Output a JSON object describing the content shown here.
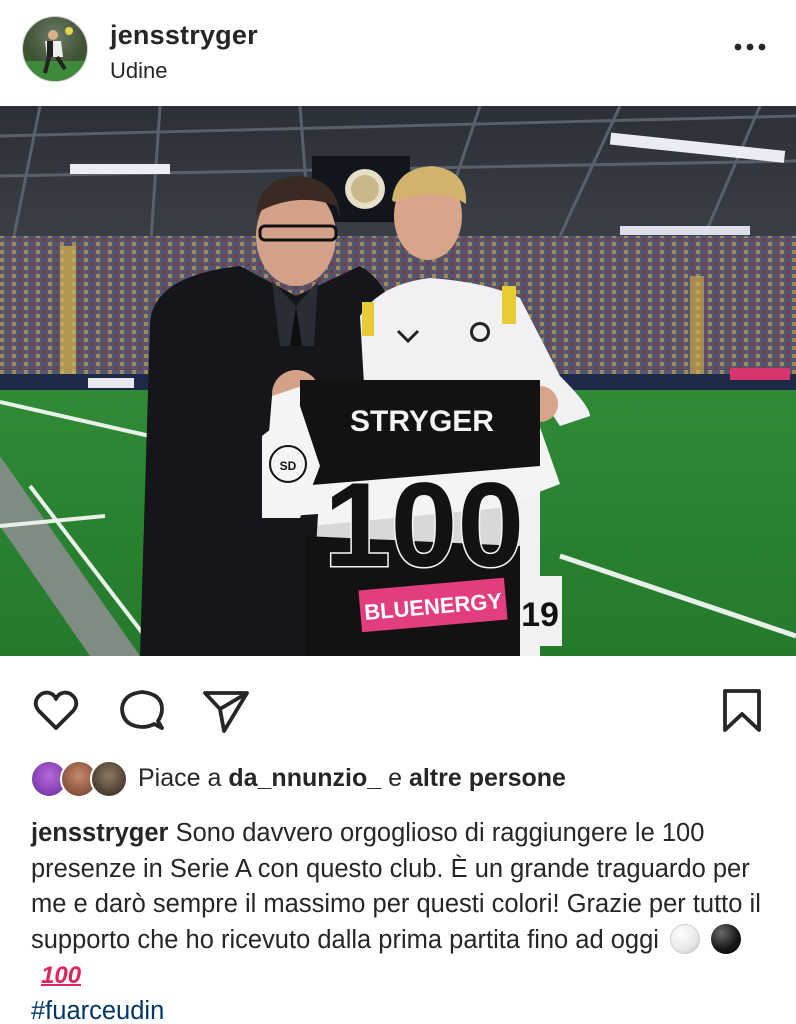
{
  "post": {
    "username": "jensstryger",
    "location": "Udine",
    "more_icon": "more-horizontal-icon"
  },
  "photo": {
    "shirt_name": "STRYGER",
    "shirt_number": "100",
    "sponsor": "BLUENERGY",
    "player_number": "19",
    "colors": {
      "sponsor_pink": "#e23d7f",
      "shirt_black": "#121212",
      "shirt_white": "#f4f4f4"
    }
  },
  "actions": {
    "like_icon": "heart-icon",
    "comment_icon": "comment-icon",
    "share_icon": "send-icon",
    "save_icon": "bookmark-icon"
  },
  "likes": {
    "prefix": "Piace a",
    "user": "da_nnunzio_",
    "connector": "e",
    "suffix": "altre persone"
  },
  "caption": {
    "username": "jensstryger",
    "text": "Sono davvero orgoglioso di raggiungere le 100 presenze in Serie A con questo club. È un grande traguardo per me e darò sempre il massimo per questi colori! Grazie per tutto il supporto che ho ricevuto dalla prima partita fino ad oggi",
    "emoji_1": "white-circle",
    "emoji_2": "black-circle",
    "emoji_3": "100",
    "hashtag": "#fuarceudin"
  }
}
